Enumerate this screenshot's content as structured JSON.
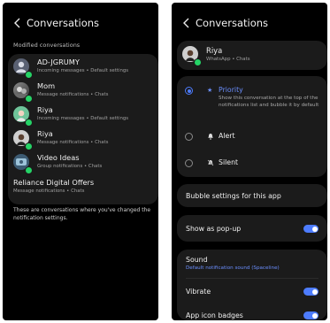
{
  "left": {
    "title": "Conversations",
    "section_label": "Modified conversations",
    "conversations": [
      {
        "name": "AD-JGRUMY",
        "subtitle": "Incoming messages • Default settings",
        "avatar": "person-icon"
      },
      {
        "name": "Mom",
        "subtitle": "Message notifications • Chats",
        "avatar": "photo-avatar"
      },
      {
        "name": "Riya",
        "subtitle": "Incoming messages • Default settings",
        "avatar": "photo-avatar"
      },
      {
        "name": "Riya",
        "subtitle": "Message notifications • Chats",
        "avatar": "photo-avatar"
      },
      {
        "name": "Video Ideas",
        "subtitle": "Group notifications • Chats",
        "avatar": "photo-avatar"
      },
      {
        "name": "Reliance Digital Offers",
        "subtitle": "Message notifications • Chats"
      }
    ],
    "footer_note": "These are conversations where you've changed the notification settings."
  },
  "right": {
    "title": "Conversations",
    "contact": {
      "name": "Riya",
      "subtitle": "WhatsApp • Chats"
    },
    "options": [
      {
        "label": "Priority",
        "icon": "star-icon",
        "selected": true,
        "description": "Show this conversation at the top of the notifications list and bubble it by default"
      },
      {
        "label": "Alert",
        "icon": "bell-icon",
        "selected": false
      },
      {
        "label": "Silent",
        "icon": "bell-off-icon",
        "selected": false
      }
    ],
    "bubble_settings": "Bubble settings for this app",
    "show_popup": "Show as pop-up",
    "sound": "Sound",
    "sound_value": "Default notification sound (Spaceline)",
    "vibrate": "Vibrate",
    "app_icon_badges": "App icon badges"
  },
  "colors": {
    "accent": "#4d7cfe",
    "card": "#1b1b1b",
    "background": "#000000"
  }
}
